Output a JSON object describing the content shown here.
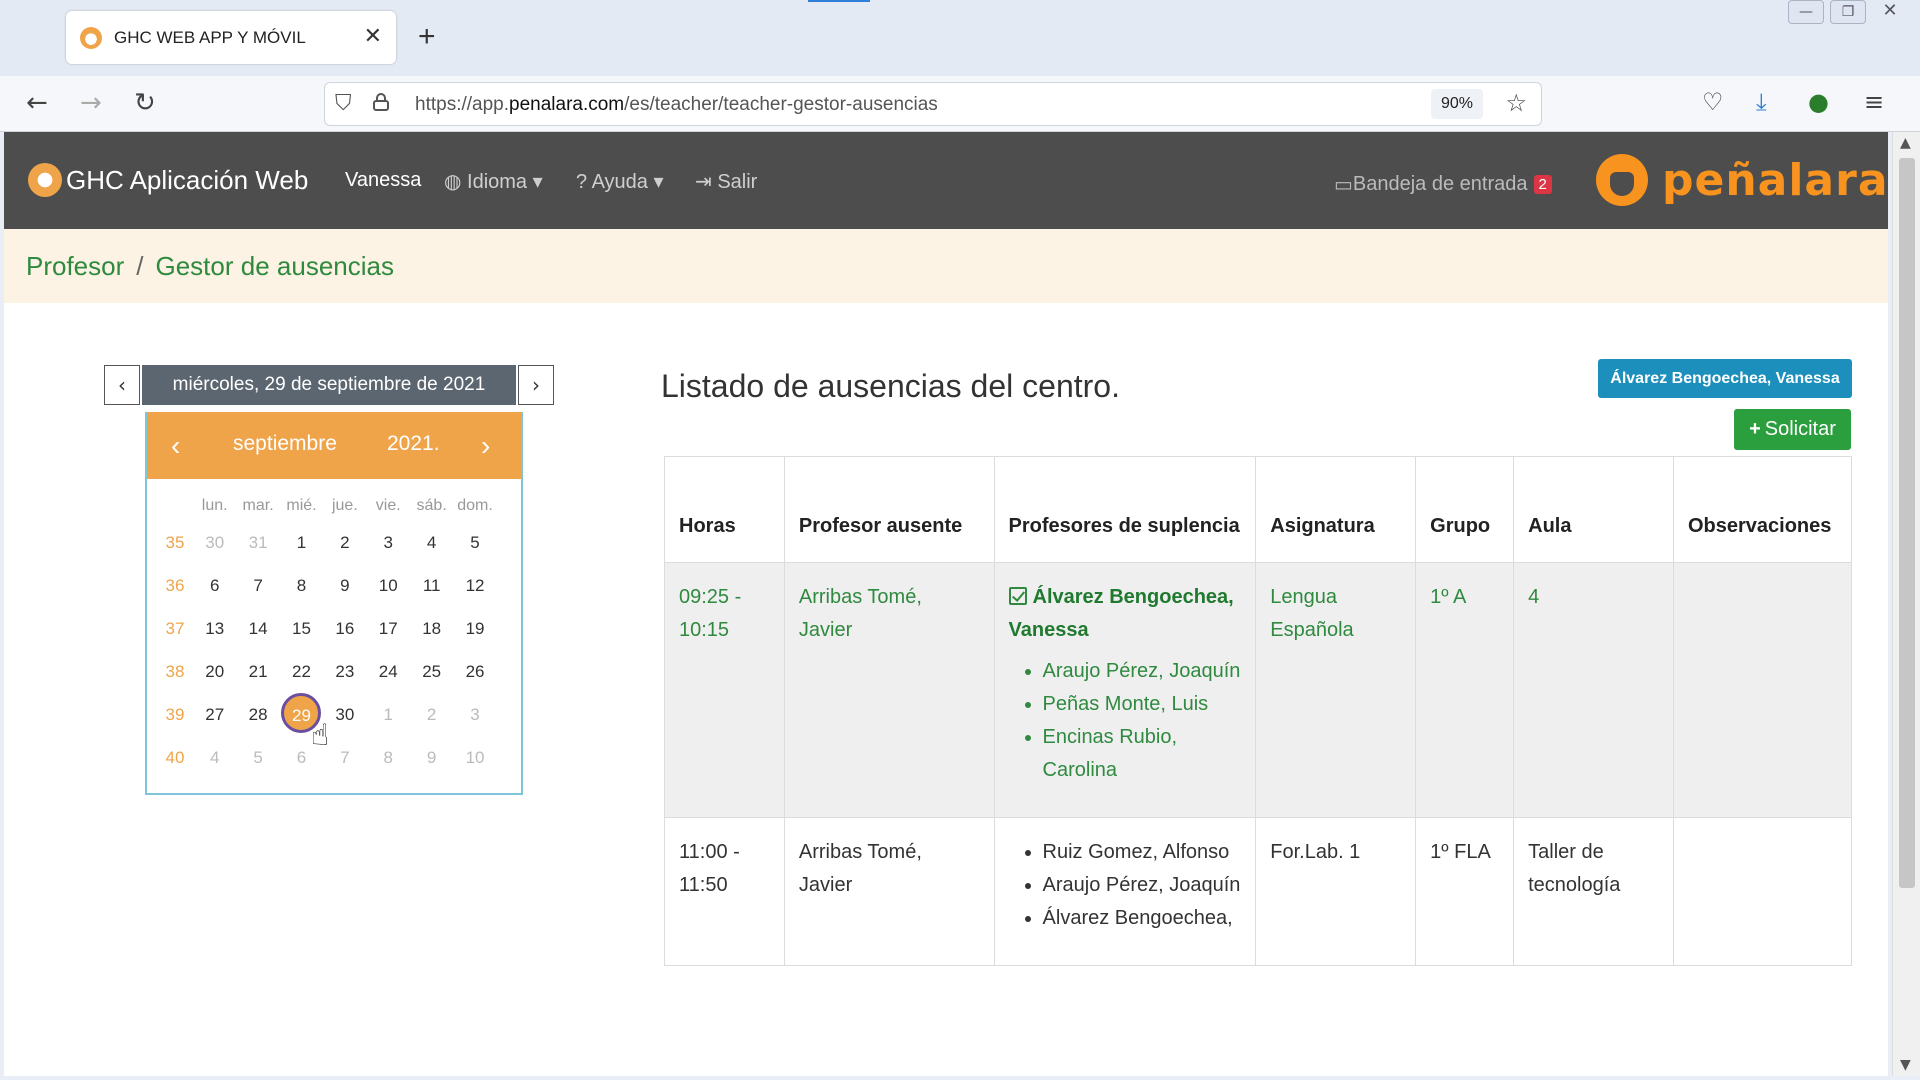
{
  "browser": {
    "tab_title": "GHC WEB APP Y MÓVIL",
    "tab_close": "✕",
    "new_tab": "+",
    "url_plain_prefix": "https://app.",
    "url_domain": "penalara.com",
    "url_path": "/es/teacher/teacher-gestor-ausencias",
    "zoom": "90%",
    "window_minimize": "—",
    "window_restore": "❐",
    "window_close": "✕"
  },
  "appnav": {
    "brand": "GHC Aplicación Web",
    "user": "Vanessa",
    "language": "Idioma",
    "help": "Ayuda",
    "logout": "Salir",
    "inbox_label": "Bandeja de entrada",
    "inbox_count": "2",
    "logo_text": "peñalara"
  },
  "breadcrumb": {
    "items": [
      "Profesor",
      "Gestor de ausencias"
    ],
    "separator": "/"
  },
  "datepicker": {
    "current_date": "miércoles, 29 de septiembre de 2021",
    "month": "septiembre",
    "year": "2021.",
    "day_headers": [
      "lun.",
      "mar.",
      "mié.",
      "jue.",
      "vie.",
      "sáb.",
      "dom."
    ],
    "weeks": [
      {
        "week": "35",
        "days": [
          "30",
          "31",
          "1",
          "2",
          "3",
          "4",
          "5"
        ]
      },
      {
        "week": "36",
        "days": [
          "6",
          "7",
          "8",
          "9",
          "10",
          "11",
          "12"
        ]
      },
      {
        "week": "37",
        "days": [
          "13",
          "14",
          "15",
          "16",
          "17",
          "18",
          "19"
        ]
      },
      {
        "week": "38",
        "days": [
          "20",
          "21",
          "22",
          "23",
          "24",
          "25",
          "26"
        ]
      },
      {
        "week": "39",
        "days": [
          "27",
          "28",
          "29",
          "30",
          "1",
          "2",
          "3"
        ]
      },
      {
        "week": "40",
        "days": [
          "4",
          "5",
          "6",
          "7",
          "8",
          "9",
          "10"
        ]
      }
    ],
    "selected_day": "29"
  },
  "main": {
    "title": "Listado de ausencias del centro.",
    "user_button": "Álvarez Bengoechea, Vanessa",
    "request_button": "Solicitar",
    "columns": [
      "Horas",
      "Profesor ausente",
      "Profesores de suplencia",
      "Asignatura",
      "Grupo",
      "Aula",
      "Observaciones"
    ],
    "rows": [
      {
        "hours": "09:25 - 10:15",
        "absent": "Arribas Tomé, Javier",
        "assigned": "Álvarez Bengoechea, Vanessa",
        "substitutes": [
          "Araujo Pérez, Joaquín",
          "Peñas Monte, Luis",
          "Encinas Rubio, Carolina"
        ],
        "subject": "Lengua Española",
        "group": "1º A",
        "room": "4",
        "notes": ""
      },
      {
        "hours": "11:00 - 11:50",
        "absent": "Arribas Tomé, Javier",
        "assigned": "",
        "substitutes": [
          "Ruiz Gomez, Alfonso",
          "Araujo Pérez, Joaquín",
          "Álvarez Bengoechea,"
        ],
        "subject": "For.Lab. 1",
        "group": "1º FLA",
        "room": "Taller de tecnología",
        "notes": ""
      }
    ]
  },
  "colors": {
    "nav_bg": "#4d4d4d",
    "brand_orange": "#f7931e",
    "calendar_orange": "#f0a44a",
    "breadcrumb_green": "#2f8a3f",
    "user_button": "#1c8fbd",
    "request_button": "#2b9e3e"
  }
}
